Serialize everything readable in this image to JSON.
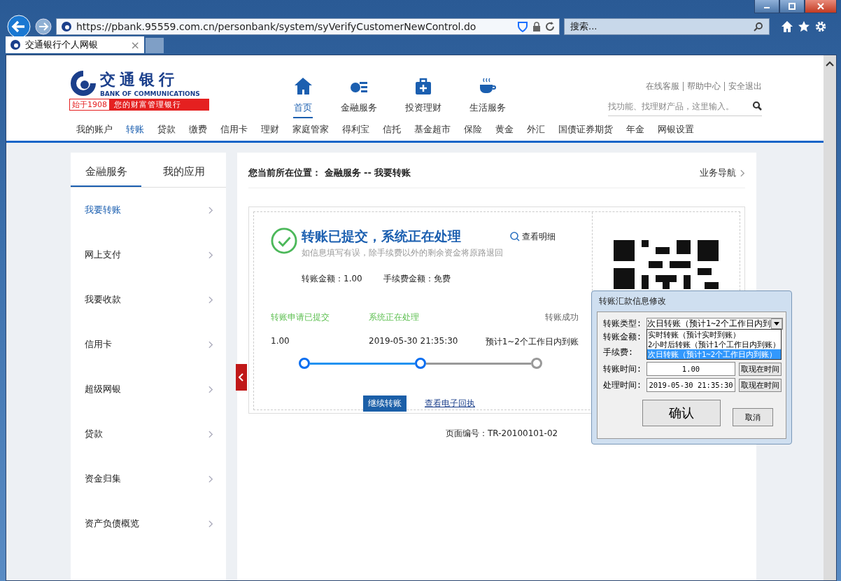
{
  "browser": {
    "url": "https://pbank.95559.com.cn/personbank/system/syVerifyCustomerNewControl.do",
    "search_placeholder": "搜索...",
    "tab": {
      "title": "交通银行个人网银",
      "close": "×"
    }
  },
  "header": {
    "logo": {
      "name_cn": "交通银行",
      "name_en": "BANK OF COMMUNICATIONS",
      "since": "始于1908",
      "slogan": "您的财富管理银行"
    },
    "nav": [
      {
        "label": "首页",
        "selected": true
      },
      {
        "label": "金融服务",
        "selected": false
      },
      {
        "label": "投资理财",
        "selected": false
      },
      {
        "label": "生活服务",
        "selected": false
      }
    ],
    "links": [
      "在线客服",
      "帮助中心",
      "安全退出"
    ],
    "search_placeholder": "找功能、找理财产品，这里输入。"
  },
  "menu": [
    {
      "label": "我的账户",
      "selected": false
    },
    {
      "label": "转账",
      "selected": true
    },
    {
      "label": "贷款",
      "selected": false
    },
    {
      "label": "缴费",
      "selected": false
    },
    {
      "label": "信用卡",
      "selected": false
    },
    {
      "label": "理财",
      "selected": false
    },
    {
      "label": "家庭管家",
      "selected": false
    },
    {
      "label": "得利宝",
      "selected": false
    },
    {
      "label": "信托",
      "selected": false
    },
    {
      "label": "基金超市",
      "selected": false
    },
    {
      "label": "保险",
      "selected": false
    },
    {
      "label": "黄金",
      "selected": false
    },
    {
      "label": "外汇",
      "selected": false
    },
    {
      "label": "国债证券期货",
      "selected": false
    },
    {
      "label": "年金",
      "selected": false
    },
    {
      "label": "网银设置",
      "selected": false
    }
  ],
  "sidebar": {
    "tabs": [
      {
        "label": "金融服务",
        "selected": true
      },
      {
        "label": "我的应用",
        "selected": false
      }
    ],
    "items": [
      {
        "label": "我要转账",
        "selected": true
      },
      {
        "label": "网上支付",
        "selected": false
      },
      {
        "label": "我要收款",
        "selected": false
      },
      {
        "label": "信用卡",
        "selected": false
      },
      {
        "label": "超级网银",
        "selected": false
      },
      {
        "label": "贷款",
        "selected": false
      },
      {
        "label": "资金归集",
        "selected": false
      },
      {
        "label": "资产负债概览",
        "selected": false
      }
    ]
  },
  "breadcrumb": "您当前所在位置： 金融服务 -- 我要转账",
  "guide_link": "业务导航",
  "result": {
    "title": "转账已提交，系统正在处理",
    "subtitle": "如信息填写有误，除手续费以外的剩余资金将原路退回",
    "detail_link": "查看明细",
    "amounts": [
      "转账金额：1.00",
      "手续费金额：免费"
    ],
    "steps": [
      {
        "label": "转账申请已提交",
        "value": "1.00",
        "done": true
      },
      {
        "label": "系统正在处理",
        "value": "2019-05-30 21:35:30",
        "done": true
      },
      {
        "label": "转账成功",
        "value": "预计1~2个工作日内到账",
        "done": false
      }
    ],
    "continue_button": "继续转账",
    "receipt_link": "查看电子回执"
  },
  "page_number": "页面编号：TR-20100101-02",
  "dialog": {
    "title": "转账汇款信息修改",
    "type_label": "转账类型:",
    "type_value": "次日转账（预计1~2个工作日内到",
    "options": [
      {
        "label": "实时转账（预计实时到账）",
        "selected": false
      },
      {
        "label": "2小时后转账（预计1个工作日内到账）",
        "selected": false
      },
      {
        "label": "次日转账（预计1~2个工作日内到账）",
        "selected": true
      }
    ],
    "hidden_labels": [
      "转账金额:",
      "手续费:"
    ],
    "rows": [
      {
        "label": "转账时间:",
        "value": "1.00",
        "button": "取现在时间"
      },
      {
        "label": "处理时间:",
        "value": "2019-05-30 21:35:30",
        "button": "取现在时间"
      }
    ],
    "confirm": "确认",
    "cancel": "取消"
  }
}
